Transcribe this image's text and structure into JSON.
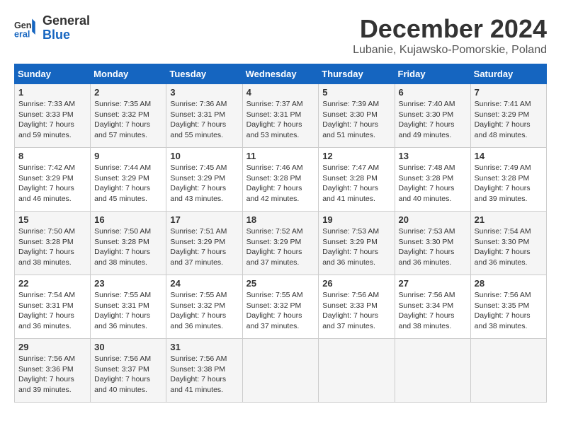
{
  "header": {
    "logo_general": "General",
    "logo_blue": "Blue",
    "month_title": "December 2024",
    "location": "Lubanie, Kujawsko-Pomorskie, Poland"
  },
  "days_of_week": [
    "Sunday",
    "Monday",
    "Tuesday",
    "Wednesday",
    "Thursday",
    "Friday",
    "Saturday"
  ],
  "weeks": [
    [
      {
        "day": "1",
        "sunrise": "7:33 AM",
        "sunset": "3:33 PM",
        "daylight": "7 hours and 59 minutes."
      },
      {
        "day": "2",
        "sunrise": "7:35 AM",
        "sunset": "3:32 PM",
        "daylight": "7 hours and 57 minutes."
      },
      {
        "day": "3",
        "sunrise": "7:36 AM",
        "sunset": "3:31 PM",
        "daylight": "7 hours and 55 minutes."
      },
      {
        "day": "4",
        "sunrise": "7:37 AM",
        "sunset": "3:31 PM",
        "daylight": "7 hours and 53 minutes."
      },
      {
        "day": "5",
        "sunrise": "7:39 AM",
        "sunset": "3:30 PM",
        "daylight": "7 hours and 51 minutes."
      },
      {
        "day": "6",
        "sunrise": "7:40 AM",
        "sunset": "3:30 PM",
        "daylight": "7 hours and 49 minutes."
      },
      {
        "day": "7",
        "sunrise": "7:41 AM",
        "sunset": "3:29 PM",
        "daylight": "7 hours and 48 minutes."
      }
    ],
    [
      {
        "day": "8",
        "sunrise": "7:42 AM",
        "sunset": "3:29 PM",
        "daylight": "7 hours and 46 minutes."
      },
      {
        "day": "9",
        "sunrise": "7:44 AM",
        "sunset": "3:29 PM",
        "daylight": "7 hours and 45 minutes."
      },
      {
        "day": "10",
        "sunrise": "7:45 AM",
        "sunset": "3:29 PM",
        "daylight": "7 hours and 43 minutes."
      },
      {
        "day": "11",
        "sunrise": "7:46 AM",
        "sunset": "3:28 PM",
        "daylight": "7 hours and 42 minutes."
      },
      {
        "day": "12",
        "sunrise": "7:47 AM",
        "sunset": "3:28 PM",
        "daylight": "7 hours and 41 minutes."
      },
      {
        "day": "13",
        "sunrise": "7:48 AM",
        "sunset": "3:28 PM",
        "daylight": "7 hours and 40 minutes."
      },
      {
        "day": "14",
        "sunrise": "7:49 AM",
        "sunset": "3:28 PM",
        "daylight": "7 hours and 39 minutes."
      }
    ],
    [
      {
        "day": "15",
        "sunrise": "7:50 AM",
        "sunset": "3:28 PM",
        "daylight": "7 hours and 38 minutes."
      },
      {
        "day": "16",
        "sunrise": "7:50 AM",
        "sunset": "3:28 PM",
        "daylight": "7 hours and 38 minutes."
      },
      {
        "day": "17",
        "sunrise": "7:51 AM",
        "sunset": "3:29 PM",
        "daylight": "7 hours and 37 minutes."
      },
      {
        "day": "18",
        "sunrise": "7:52 AM",
        "sunset": "3:29 PM",
        "daylight": "7 hours and 37 minutes."
      },
      {
        "day": "19",
        "sunrise": "7:53 AM",
        "sunset": "3:29 PM",
        "daylight": "7 hours and 36 minutes."
      },
      {
        "day": "20",
        "sunrise": "7:53 AM",
        "sunset": "3:30 PM",
        "daylight": "7 hours and 36 minutes."
      },
      {
        "day": "21",
        "sunrise": "7:54 AM",
        "sunset": "3:30 PM",
        "daylight": "7 hours and 36 minutes."
      }
    ],
    [
      {
        "day": "22",
        "sunrise": "7:54 AM",
        "sunset": "3:31 PM",
        "daylight": "7 hours and 36 minutes."
      },
      {
        "day": "23",
        "sunrise": "7:55 AM",
        "sunset": "3:31 PM",
        "daylight": "7 hours and 36 minutes."
      },
      {
        "day": "24",
        "sunrise": "7:55 AM",
        "sunset": "3:32 PM",
        "daylight": "7 hours and 36 minutes."
      },
      {
        "day": "25",
        "sunrise": "7:55 AM",
        "sunset": "3:32 PM",
        "daylight": "7 hours and 37 minutes."
      },
      {
        "day": "26",
        "sunrise": "7:56 AM",
        "sunset": "3:33 PM",
        "daylight": "7 hours and 37 minutes."
      },
      {
        "day": "27",
        "sunrise": "7:56 AM",
        "sunset": "3:34 PM",
        "daylight": "7 hours and 38 minutes."
      },
      {
        "day": "28",
        "sunrise": "7:56 AM",
        "sunset": "3:35 PM",
        "daylight": "7 hours and 38 minutes."
      }
    ],
    [
      {
        "day": "29",
        "sunrise": "7:56 AM",
        "sunset": "3:36 PM",
        "daylight": "7 hours and 39 minutes."
      },
      {
        "day": "30",
        "sunrise": "7:56 AM",
        "sunset": "3:37 PM",
        "daylight": "7 hours and 40 minutes."
      },
      {
        "day": "31",
        "sunrise": "7:56 AM",
        "sunset": "3:38 PM",
        "daylight": "7 hours and 41 minutes."
      },
      null,
      null,
      null,
      null
    ]
  ],
  "labels": {
    "sunrise_prefix": "Sunrise: ",
    "sunset_prefix": "Sunset: ",
    "daylight_prefix": "Daylight: "
  }
}
